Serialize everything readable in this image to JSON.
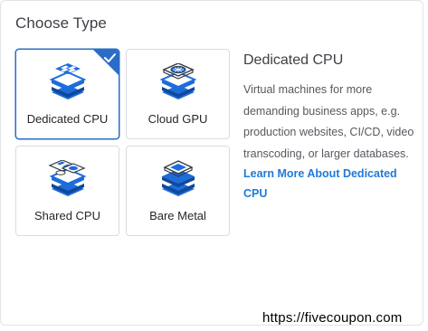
{
  "section": {
    "title": "Choose Type"
  },
  "types": [
    {
      "label": "Dedicated CPU",
      "icon": "dedicated-cpu-icon",
      "selected": true
    },
    {
      "label": "Cloud GPU",
      "icon": "cloud-gpu-icon",
      "selected": false
    },
    {
      "label": "Shared CPU",
      "icon": "shared-cpu-icon",
      "selected": false
    },
    {
      "label": "Bare Metal",
      "icon": "bare-metal-icon",
      "selected": false
    }
  ],
  "details": {
    "title": "Dedicated CPU",
    "description": "Virtual machines for more demanding business apps, e.g. production websites, CI/CD, video transcoding, or larger databases.",
    "link_label": "Learn More About Dedicated CPU"
  },
  "watermark": "https://fivecoupon.com",
  "colors": {
    "accent": "#2a6dc6",
    "link": "#1f7ad8",
    "icon_blue": "#1c6cdc"
  }
}
